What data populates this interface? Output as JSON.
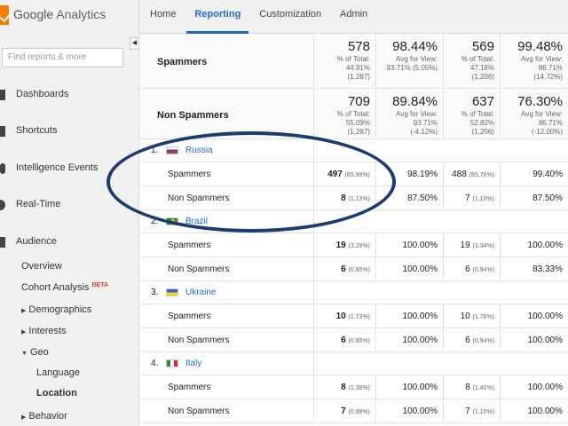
{
  "app": {
    "brand": "Google",
    "product": "Analytics",
    "accent": "#1e6bc6",
    "logo_color": "#f57c00"
  },
  "nav": [
    {
      "label": "Home"
    },
    {
      "label": "Reporting",
      "active": true
    },
    {
      "label": "Customization"
    },
    {
      "label": "Admin"
    }
  ],
  "sidebar": {
    "search_placeholder": "Find reports & more",
    "collapse_glyph": "◀",
    "items": [
      {
        "label": "Dashboards",
        "icon": "grid-icon"
      },
      {
        "label": "Shortcuts",
        "icon": "arrow-icon"
      },
      {
        "label": "Intelligence Events",
        "icon": "bulb-icon"
      },
      {
        "label": "Real-Time",
        "icon": "clock-icon"
      },
      {
        "label": "Audience",
        "icon": "person-icon"
      }
    ],
    "audience_sub": {
      "overview": "Overview",
      "cohort": "Cohort Analysis",
      "beta": "BETA",
      "demographics": "Demographics",
      "interests": "Interests",
      "geo": "Geo",
      "language": "Language",
      "location": "Location",
      "behavior": "Behavior"
    }
  },
  "summary": [
    {
      "label": "Spammers",
      "c1": {
        "big": "578",
        "l1": "% of Total:",
        "l2": "44.91%",
        "l3": "(1,287)"
      },
      "c2": {
        "big": "98.44%",
        "l1": "Avg for View:",
        "l2": "93.71% (5.05%)"
      },
      "c3": {
        "big": "569",
        "l1": "% of Total:",
        "l2": "47.18%",
        "l3": "(1,206)"
      },
      "c4": {
        "big": "99.48%",
        "l1": "Avg for View:",
        "l2": "86.71%",
        "l3": "(14.72%)"
      }
    },
    {
      "label": "Non Spammers",
      "c1": {
        "big": "709",
        "l1": "% of Total:",
        "l2": "55.09%",
        "l3": "(1,287)"
      },
      "c2": {
        "big": "89.84%",
        "l1": "Avg for View:",
        "l2": "93.71%",
        "l3": "(-4.12%)"
      },
      "c3": {
        "big": "637",
        "l1": "% of Total:",
        "l2": "52.82%",
        "l3": "(1,206)"
      },
      "c4": {
        "big": "76.30%",
        "l1": "Avg for View:",
        "l2": "86.71%",
        "l3": "(-12.00%)"
      }
    }
  ],
  "countries": [
    {
      "num": "1.",
      "name": "Russia",
      "flag": [
        "#ffffff",
        "#3a4fb0",
        "#d32f2f"
      ],
      "rows": [
        {
          "label": "Spammers",
          "v1": "497",
          "p1": "(85.99%)",
          "v2": "98.19%",
          "v3": "488",
          "p3": "(85.76%)",
          "v4": "99.40%"
        },
        {
          "label": "Non Spammers",
          "v1": "8",
          "p1": "(1.13%)",
          "v2": "87.50%",
          "v3": "7",
          "p3": "(1.10%)",
          "v4": "87.50%"
        }
      ]
    },
    {
      "num": "2.",
      "name": "Brazil",
      "flag": [
        "#2e8b3a",
        "#f5d21c",
        "#2a4aa0"
      ],
      "rows": [
        {
          "label": "Spammers",
          "v1": "19",
          "p1": "(3.29%)",
          "v2": "100.00%",
          "v3": "19",
          "p3": "(3.34%)",
          "v4": "100.00%"
        },
        {
          "label": "Non Spammers",
          "v1": "6",
          "p1": "(0.85%)",
          "v2": "100.00%",
          "v3": "6",
          "p3": "(0.94%)",
          "v4": "83.33%"
        }
      ]
    },
    {
      "num": "3.",
      "name": "Ukraine",
      "flag": [
        "#2f63c9",
        "#f5d21c"
      ],
      "rows": [
        {
          "label": "Spammers",
          "v1": "10",
          "p1": "(1.73%)",
          "v2": "100.00%",
          "v3": "10",
          "p3": "(1.76%)",
          "v4": "100.00%"
        },
        {
          "label": "Non Spammers",
          "v1": "6",
          "p1": "(0.85%)",
          "v2": "100.00%",
          "v3": "6",
          "p3": "(0.94%)",
          "v4": "100.00%"
        }
      ]
    },
    {
      "num": "4.",
      "name": "Italy",
      "flag": [
        "#2e8b3a",
        "#ffffff",
        "#d32f2f"
      ],
      "rows": [
        {
          "label": "Spammers",
          "v1": "8",
          "p1": "(1.38%)",
          "v2": "100.00%",
          "v3": "8",
          "p3": "(1.41%)",
          "v4": "100.00%"
        },
        {
          "label": "Non Spammers",
          "v1": "7",
          "p1": "(0.99%)",
          "v2": "100.00%",
          "v3": "7",
          "p3": "(1.10%)",
          "v4": "100.00%"
        }
      ]
    }
  ],
  "annotation_color": "#1c3b73"
}
